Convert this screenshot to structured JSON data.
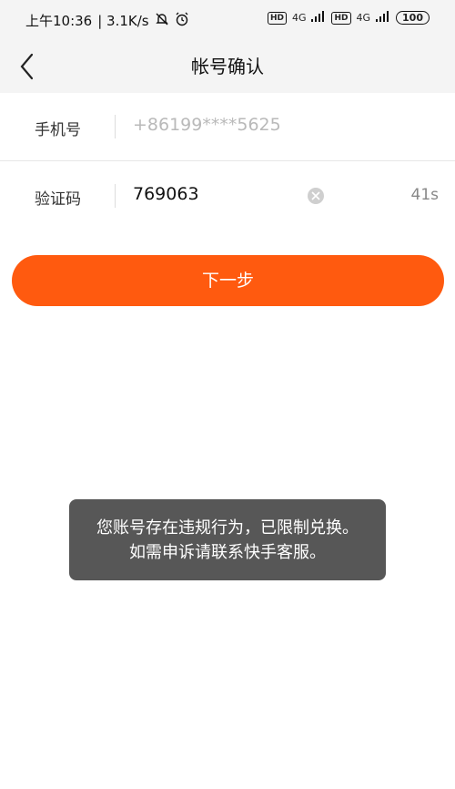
{
  "status_bar": {
    "time": "上午10:36",
    "speed": "| 3.1K/s",
    "hd1": "HD",
    "net1": "4G",
    "hd2": "HD",
    "net2": "4G",
    "battery": "100"
  },
  "header": {
    "title": "帐号确认"
  },
  "form": {
    "phone_label": "手机号",
    "phone_value": "+86199****5625",
    "code_label": "验证码",
    "code_value": "769063",
    "countdown": "41s"
  },
  "next_button_label": "下一步",
  "toast_message": "您账号存在违规行为，已限制兑换。如需申诉请联系快手客服。",
  "colors": {
    "accent": "#ff5a0f",
    "toast_bg": "#575757"
  }
}
